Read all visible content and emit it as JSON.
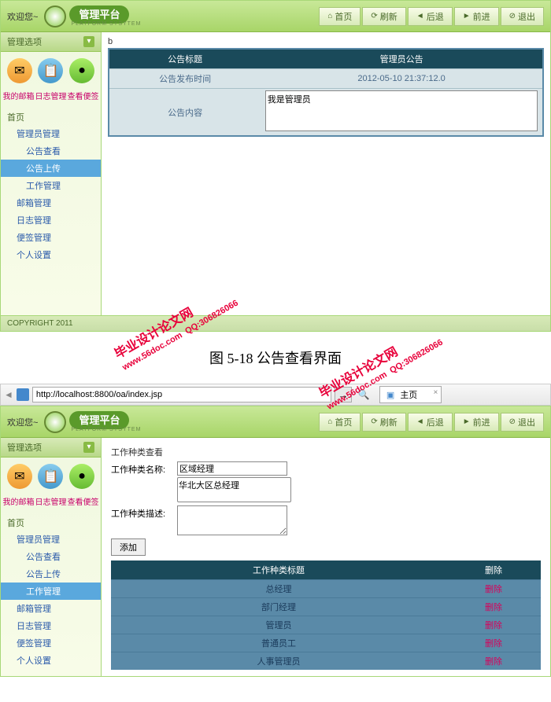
{
  "header": {
    "welcome": "欢迎您~",
    "platform": "管理平台",
    "platform_sub": "PLATFORM SYSYTEM",
    "nav": {
      "home": "首页",
      "refresh": "刷新",
      "back": "后退",
      "forward": "前进",
      "exit": "退出"
    }
  },
  "sidebar": {
    "title": "管理选项",
    "quicklinks": {
      "mailbox": "我的邮箱",
      "log": "日志管理",
      "notes": "查看便签"
    },
    "root": "首页",
    "items": [
      {
        "label": "管理员管理",
        "sub": false
      },
      {
        "label": "公告查看",
        "sub": true
      },
      {
        "label": "公告上传",
        "sub": true
      },
      {
        "label": "工作管理",
        "sub": true
      },
      {
        "label": "邮箱管理",
        "sub": false
      },
      {
        "label": "日志管理",
        "sub": false
      },
      {
        "label": "便签管理",
        "sub": false
      },
      {
        "label": "个人设置",
        "sub": false
      }
    ]
  },
  "panel1": {
    "top_label": "b",
    "active_menu_index": 2,
    "table": {
      "header1": "公告标题",
      "header2": "管理员公告",
      "row1_label": "公告发布时间",
      "row1_value": "2012-05-10 21:37:12.0",
      "row2_label": "公告内容",
      "row2_value": "我是管理员"
    }
  },
  "footer": {
    "text": "COPYRIGHT  2011"
  },
  "watermark": {
    "main": "毕业设计论文网",
    "url": "www.56doc.com",
    "qq": "QQ:306826066"
  },
  "caption": "图 5-18   公告查看界面",
  "browser": {
    "url": "http://localhost:8800/oa/index.jsp",
    "tab_title": "主页"
  },
  "panel2": {
    "active_menu_index": 3,
    "form": {
      "title": "工作种类查看",
      "name_label": "工作种类名称:",
      "name_value": "区域经理",
      "select_option": "华北大区总经理",
      "desc_label": "工作种类描述:",
      "desc_value": "",
      "add_button": "添加"
    },
    "list": {
      "header1": "工作种类标题",
      "header2": "删除",
      "rows": [
        {
          "title": "总经理",
          "action": "删除"
        },
        {
          "title": "部门经理",
          "action": "删除"
        },
        {
          "title": "管理员",
          "action": "删除"
        },
        {
          "title": "普通员工",
          "action": "删除"
        },
        {
          "title": "人事管理员",
          "action": "删除"
        }
      ]
    }
  }
}
